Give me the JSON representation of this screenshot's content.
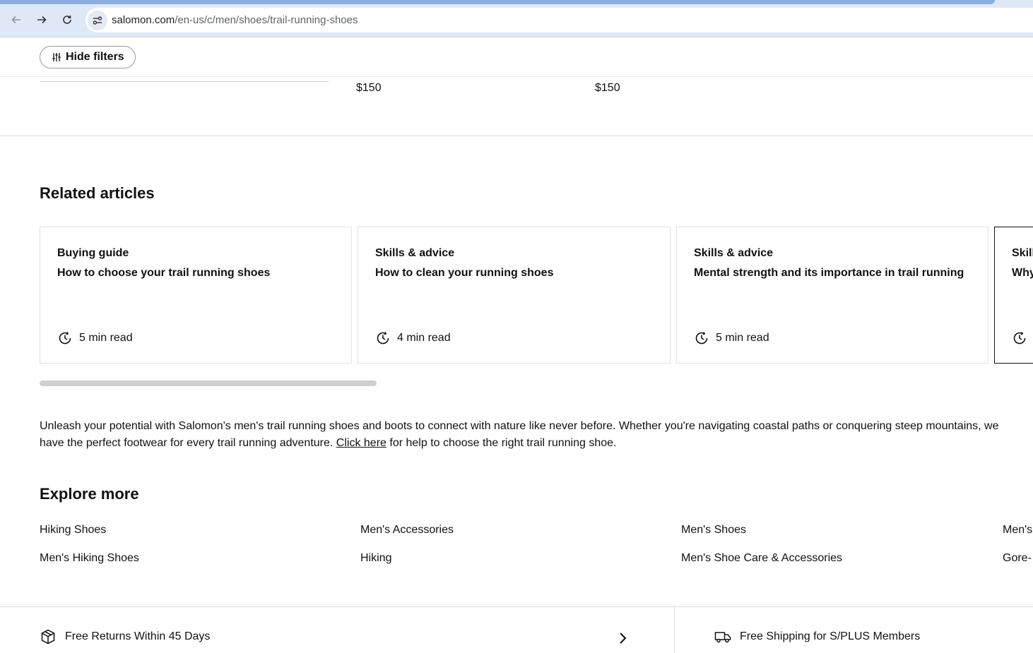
{
  "browser": {
    "url_domain": "salomon.com",
    "url_path": "/en-us/c/men/shoes/trail-running-shoes",
    "icons": [
      "back-arrow-icon",
      "forward-arrow-icon",
      "reload-icon",
      "site-settings-icon"
    ]
  },
  "filters": {
    "hide_filters_label": "Hide filters"
  },
  "products": {
    "price_1": "$150",
    "price_2": "$150"
  },
  "related": {
    "heading": "Related articles",
    "cards": [
      {
        "category": "Buying guide",
        "title": "How to choose your trail running shoes",
        "read": "5 min read"
      },
      {
        "category": "Skills & advice",
        "title": "How to clean your running shoes",
        "read": "4 min read"
      },
      {
        "category": "Skills & advice",
        "title": "Mental strength and its importance in trail running",
        "read": "5 min read"
      },
      {
        "category": "Skill",
        "title": "Why",
        "read": ""
      }
    ]
  },
  "intro": {
    "text_before": "Unleash your potential with Salomon's men's trail running shoes and boots to connect with nature like never before. Whether you're navigating coastal paths or conquering steep mountains, we have the perfect footwear for every trail running adventure. ",
    "link": "Click here",
    "text_after": " for help to choose the right trail running shoe."
  },
  "explore": {
    "heading": "Explore more",
    "links": [
      "Hiking Shoes",
      "Men's Accessories",
      "Men's Shoes",
      "Men's",
      "Men's Hiking Shoes",
      "Hiking",
      "Men's Shoe Care & Accessories",
      "Gore-"
    ]
  },
  "footer": {
    "returns": "Free Returns Within 45 Days",
    "shipping": "Free Shipping for S/PLUS Members"
  }
}
